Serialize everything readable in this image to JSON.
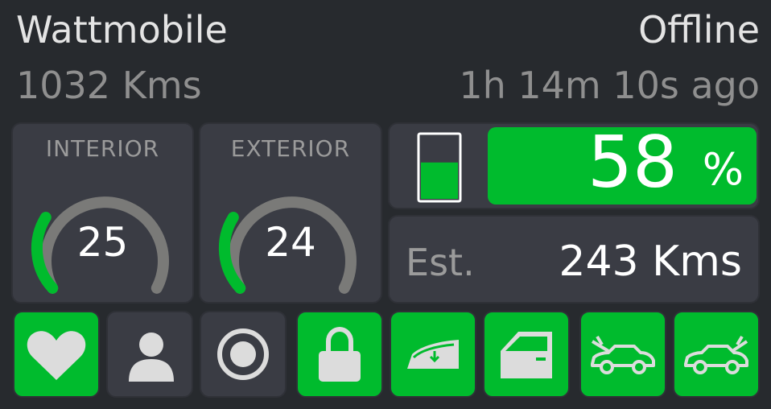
{
  "vehicle": {
    "name": "Wattmobile",
    "status": "Offline",
    "odometer": "1032 Kms",
    "last_seen": "1h 14m 10s ago"
  },
  "climate": {
    "interior": {
      "label": "INTERIOR",
      "value": "25"
    },
    "exterior": {
      "label": "EXTERIOR",
      "value": "24"
    }
  },
  "battery": {
    "percent": 58,
    "percent_text": "58",
    "unit": "%"
  },
  "range": {
    "label": "Est.",
    "value": "243 Kms"
  },
  "status_tiles": [
    {
      "icon": "heart-icon",
      "active": true
    },
    {
      "icon": "user-icon",
      "active": false
    },
    {
      "icon": "sentry-icon",
      "active": false
    },
    {
      "icon": "lock-icon",
      "active": true
    },
    {
      "icon": "sunroof-icon",
      "active": true
    },
    {
      "icon": "door-icon",
      "active": true
    },
    {
      "icon": "frunk-icon",
      "active": true
    },
    {
      "icon": "trunk-icon",
      "active": true
    }
  ],
  "colors": {
    "background": "#272a2e",
    "panel": "#3a3c44",
    "accent": "#00bb2d",
    "text": "#e4e4e4",
    "muted_text": "#8f8f8f",
    "gauge_track": "#7a7a78"
  }
}
